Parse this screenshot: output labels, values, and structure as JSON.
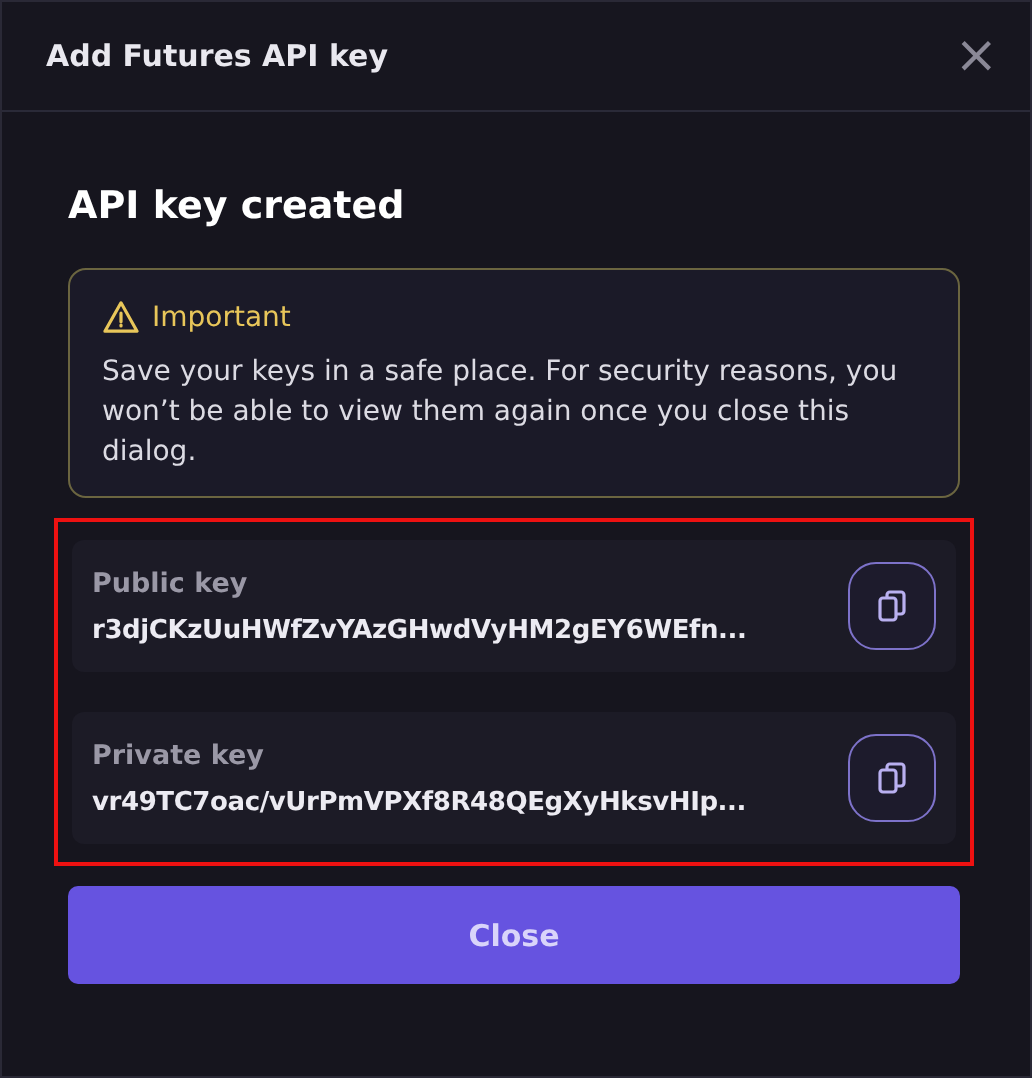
{
  "dialog": {
    "title": "Add Futures API key",
    "close_icon": "×"
  },
  "heading": "API key created",
  "notice": {
    "title": "Important",
    "text": "Save your keys in a safe place. For security reasons, you won’t be able to view them again once you close this dialog."
  },
  "keys_section": {
    "highlighted": true,
    "keys": [
      {
        "label": "Public key",
        "value": "r3djCKzUuHWfZvYAzGHwdVyHM2gEY6WEfn..."
      },
      {
        "label": "Private key",
        "value": "vr49TC7oac/vUrPmVPXf8R48QEgXyHksvHIp..."
      }
    ]
  },
  "button": "Close"
}
